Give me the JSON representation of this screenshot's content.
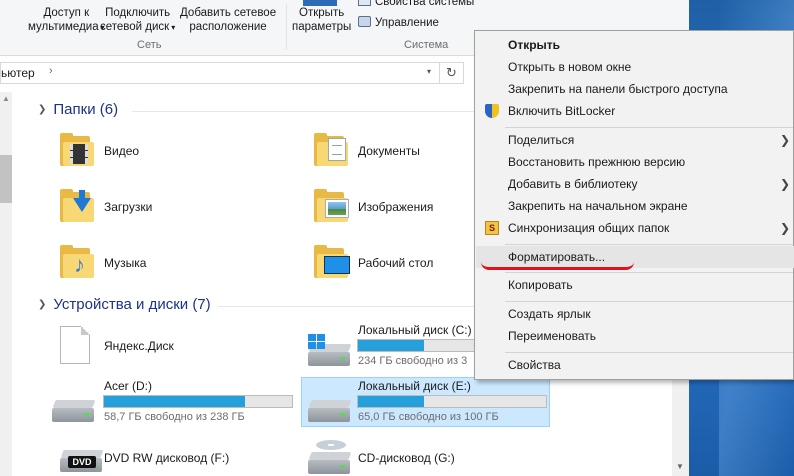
{
  "ribbon": {
    "media_access": {
      "line1": "Доступ к",
      "line2": "мультимедиа"
    },
    "map_drive": {
      "line1": "Подключить",
      "line2": "сетевой диск"
    },
    "add_location": {
      "line1": "Добавить сетевое",
      "line2": "расположение"
    },
    "open_settings": {
      "line1": "Открыть",
      "line2": "параметры"
    },
    "system_properties": "Свойства системы",
    "manage": "Управление",
    "group_network": "Сеть",
    "group_system": "Система"
  },
  "address": {
    "text": "ьютер",
    "chevron": "›",
    "refresh": "↻"
  },
  "sections": {
    "folders": "Папки (6)",
    "devices": "Устройства и диски (7)"
  },
  "folders": [
    {
      "label": "Видео",
      "icon": "video-icon"
    },
    {
      "label": "Документы",
      "icon": "documents-icon"
    },
    {
      "label": "Загрузки",
      "icon": "downloads-icon"
    },
    {
      "label": "Изображения",
      "icon": "pictures-icon"
    },
    {
      "label": "Музыка",
      "icon": "music-icon"
    },
    {
      "label": "Рабочий стол",
      "icon": "desktop-icon"
    }
  ],
  "drives": [
    {
      "name": "Яндекс.Диск"
    },
    {
      "name": "Локальный диск (C:)",
      "free": "234 ГБ свободно из 3",
      "used_fraction": 0.35
    },
    {
      "name": "Acer (D:)",
      "free": "58,7 ГБ свободно из 238 ГБ",
      "used_fraction": 0.75
    },
    {
      "name": "Локальный диск (E:)",
      "free": "65,0 ГБ свободно из 100 ГБ",
      "used_fraction": 0.35
    },
    {
      "name": "DVD RW дисковод (F:)",
      "badge": "DVD"
    },
    {
      "name": "CD-дисковод (G:)"
    }
  ],
  "context_menu": {
    "open": "Открыть",
    "open_new_window": "Открыть в новом окне",
    "pin_quick_access": "Закрепить на панели быстрого доступа",
    "bitlocker": "Включить BitLocker",
    "share": "Поделиться",
    "restore_version": "Восстановить прежнюю версию",
    "add_to_library": "Добавить в библиотеку",
    "pin_start": "Закрепить на начальном экране",
    "sync_folders": "Синхронизация общих папок",
    "sync_icon_letter": "S",
    "format": "Форматировать...",
    "copy": "Копировать",
    "create_shortcut": "Создать ярлык",
    "rename": "Переименовать",
    "properties": "Свойства"
  },
  "colors": {
    "accent": "#26a0da",
    "section_heading": "#1e3287",
    "selection": "#cce8ff",
    "highlight_underline": "#e0121b"
  }
}
